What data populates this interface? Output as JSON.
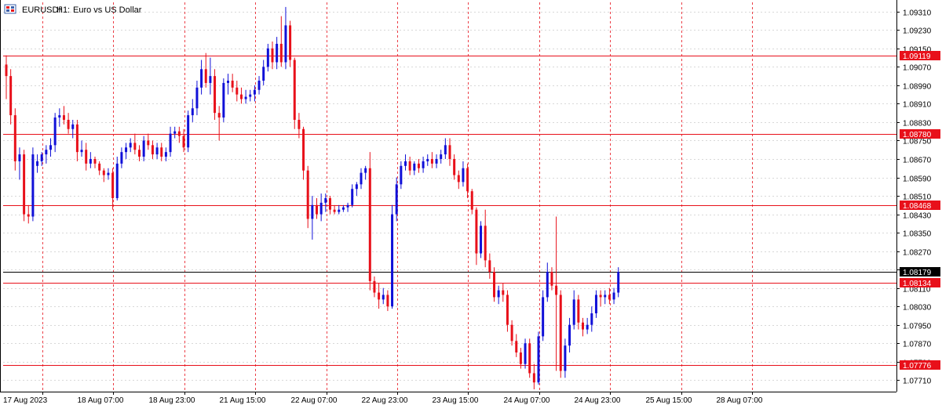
{
  "header": {
    "symbol": "EURUSDf",
    "timeframe": "H1:",
    "description": "Euro vs US Dollar",
    "icon": "chart-window-icon"
  },
  "colors": {
    "bull": "#1010d8",
    "bear": "#e8101a",
    "doji": "#4caf50",
    "hline": "#e8101a",
    "current_line": "#000000",
    "grid": "#d8d8d8",
    "vgrid": "#e8101a",
    "axis": "#000000"
  },
  "price_axis": {
    "min": 1.0766,
    "max": 1.0935,
    "ticks": [
      "1.09310",
      "1.09230",
      "1.09150",
      "1.09070",
      "1.08990",
      "1.08910",
      "1.08830",
      "1.08750",
      "1.08670",
      "1.08590",
      "1.08510",
      "1.08430",
      "1.08350",
      "1.08270",
      "1.08190",
      "1.08110",
      "1.08030",
      "1.07950",
      "1.07870",
      "1.07790",
      "1.07710"
    ]
  },
  "time_axis": {
    "labels": [
      "17 Aug 2023",
      "18 Aug 07:00",
      "18 Aug 23:00",
      "21 Aug 15:00",
      "22 Aug 07:00",
      "22 Aug 23:00",
      "23 Aug 15:00",
      "24 Aug 07:00",
      "24 Aug 23:00",
      "25 Aug 15:00",
      "28 Aug 07:00"
    ],
    "label_bar_index": [
      0,
      16,
      32,
      48,
      64,
      80,
      96,
      112,
      128,
      144,
      160
    ]
  },
  "horizontal_levels": [
    {
      "price": 1.09119,
      "label": "1.09119"
    },
    {
      "price": 1.0878,
      "label": "1.08780"
    },
    {
      "price": 1.08468,
      "label": "1.08468"
    },
    {
      "price": 1.08134,
      "label": "1.08134"
    },
    {
      "price": 1.07776,
      "label": "1.07776"
    }
  ],
  "current_price": {
    "price": 1.08179,
    "label": "1.08179"
  },
  "chart_data": {
    "type": "candlestick",
    "symbol": "EURUSDf",
    "timeframe": "H1",
    "candles": [
      [
        1.0908,
        1.0912,
        1.0893,
        1.0903
      ],
      [
        1.0903,
        1.0906,
        1.0882,
        1.0886
      ],
      [
        1.0886,
        1.0889,
        1.0862,
        1.0866
      ],
      [
        1.0866,
        1.0872,
        1.0858,
        1.0869
      ],
      [
        1.0869,
        1.0871,
        1.084,
        1.0843
      ],
      [
        1.0843,
        1.0847,
        1.0839,
        1.0842
      ],
      [
        1.0842,
        1.0872,
        1.084,
        1.0869
      ],
      [
        1.0864,
        1.0869,
        1.0861,
        1.0866
      ],
      [
        1.0866,
        1.087,
        1.0864,
        1.0869
      ],
      [
        1.0869,
        1.0873,
        1.0865,
        1.0871
      ],
      [
        1.0871,
        1.0876,
        1.0868,
        1.0873
      ],
      [
        1.0873,
        1.0887,
        1.087,
        1.0885
      ],
      [
        1.0885,
        1.0889,
        1.0881,
        1.0886
      ],
      [
        1.0886,
        1.089,
        1.0882,
        1.0884
      ],
      [
        1.0884,
        1.0887,
        1.0878,
        1.088
      ],
      [
        1.088,
        1.0884,
        1.0876,
        1.0882
      ],
      [
        1.0882,
        1.0884,
        1.0866,
        1.087
      ],
      [
        1.087,
        1.0875,
        1.0868,
        1.0871
      ],
      [
        1.0871,
        1.0874,
        1.0862,
        1.0865
      ],
      [
        1.0865,
        1.087,
        1.0863,
        1.0867
      ],
      [
        1.0867,
        1.0868,
        1.0863,
        1.0865
      ],
      [
        1.0865,
        1.0866,
        1.086,
        1.0862
      ],
      [
        1.0862,
        1.0863,
        1.0857,
        1.086
      ],
      [
        1.086,
        1.0863,
        1.0858,
        1.0861
      ],
      [
        1.0861,
        1.0863,
        1.0845,
        1.085
      ],
      [
        1.085,
        1.0868,
        1.0849,
        1.0865
      ],
      [
        1.0865,
        1.0872,
        1.0863,
        1.087
      ],
      [
        1.087,
        1.0874,
        1.0867,
        1.0872
      ],
      [
        1.0872,
        1.0876,
        1.087,
        1.0874
      ],
      [
        1.0874,
        1.0878,
        1.0869,
        1.0871
      ],
      [
        1.0871,
        1.0873,
        1.0866,
        1.0868
      ],
      [
        1.0868,
        1.0877,
        1.0866,
        1.0875
      ],
      [
        1.0875,
        1.0878,
        1.0871,
        1.0873
      ],
      [
        1.0873,
        1.0875,
        1.0867,
        1.0869
      ],
      [
        1.0869,
        1.0874,
        1.0867,
        1.0872
      ],
      [
        1.0872,
        1.0874,
        1.0866,
        1.0868
      ],
      [
        1.0868,
        1.0872,
        1.0866,
        1.087
      ],
      [
        1.087,
        1.0881,
        1.0868,
        1.0878
      ],
      [
        1.0878,
        1.0881,
        1.0876,
        1.0879
      ],
      [
        1.0879,
        1.0881,
        1.0874,
        1.0877
      ],
      [
        1.0877,
        1.088,
        1.087,
        1.0872
      ],
      [
        1.0872,
        1.0888,
        1.087,
        1.0886
      ],
      [
        1.0886,
        1.0893,
        1.0883,
        1.0889
      ],
      [
        1.0889,
        1.0901,
        1.0886,
        1.0898
      ],
      [
        1.0898,
        1.091,
        1.0895,
        1.0906
      ],
      [
        1.0906,
        1.0913,
        1.0898,
        1.09
      ],
      [
        1.09,
        1.0911,
        1.0895,
        1.0903
      ],
      [
        1.0903,
        1.0906,
        1.0884,
        1.0887
      ],
      [
        1.0887,
        1.089,
        1.0875,
        1.0885
      ],
      [
        1.0885,
        1.0902,
        1.0883,
        1.09
      ],
      [
        1.09,
        1.0904,
        1.0895,
        1.0901
      ],
      [
        1.0901,
        1.0904,
        1.0896,
        1.0898
      ],
      [
        1.0898,
        1.0901,
        1.0892,
        1.0895
      ],
      [
        1.0895,
        1.0898,
        1.0891,
        1.0893
      ],
      [
        1.0893,
        1.0897,
        1.0891,
        1.0894
      ],
      [
        1.0894,
        1.0897,
        1.0892,
        1.0895
      ],
      [
        1.0895,
        1.0899,
        1.0892,
        1.0897
      ],
      [
        1.0897,
        1.0903,
        1.0895,
        1.0901
      ],
      [
        1.0901,
        1.091,
        1.0899,
        1.0907
      ],
      [
        1.0907,
        1.0917,
        1.0905,
        1.0915
      ],
      [
        1.0915,
        1.0918,
        1.0906,
        1.0909
      ],
      [
        1.0909,
        1.092,
        1.0906,
        1.0917
      ],
      [
        1.0917,
        1.0929,
        1.0907,
        1.0909
      ],
      [
        1.0909,
        1.0933,
        1.0906,
        1.0925
      ],
      [
        1.0925,
        1.0927,
        1.0907,
        1.091
      ],
      [
        1.091,
        1.0911,
        1.088,
        1.0884
      ],
      [
        1.0884,
        1.0887,
        1.0876,
        1.088
      ],
      [
        1.088,
        1.0881,
        1.0858,
        1.0862
      ],
      [
        1.0862,
        1.0864,
        1.0837,
        1.0841
      ],
      [
        1.0841,
        1.0851,
        1.0832,
        1.0847
      ],
      [
        1.0847,
        1.085,
        1.0841,
        1.0843
      ],
      [
        1.0843,
        1.0852,
        1.084,
        1.0848
      ],
      [
        1.0848,
        1.0852,
        1.0844,
        1.085
      ],
      [
        1.085,
        1.0851,
        1.0843,
        1.0845
      ],
      [
        1.0845,
        1.0847,
        1.0843,
        1.0844
      ],
      [
        1.0844,
        1.0847,
        1.0843,
        1.0845
      ],
      [
        1.0845,
        1.0847,
        1.0844,
        1.0846
      ],
      [
        1.0846,
        1.0848,
        1.0844,
        1.0847
      ],
      [
        1.0847,
        1.0856,
        1.0846,
        1.0854
      ],
      [
        1.0854,
        1.0857,
        1.0851,
        1.0856
      ],
      [
        1.0856,
        1.0863,
        1.0854,
        1.0861
      ],
      [
        1.0861,
        1.0864,
        1.0858,
        1.0863
      ],
      [
        1.0863,
        1.087,
        1.081,
        1.0814
      ],
      [
        1.0814,
        1.0816,
        1.0807,
        1.0809
      ],
      [
        1.0809,
        1.0813,
        1.0802,
        1.0806
      ],
      [
        1.0806,
        1.0811,
        1.0804,
        1.0808
      ],
      [
        1.0808,
        1.081,
        1.0801,
        1.0803
      ],
      [
        1.0803,
        1.0847,
        1.0802,
        1.0843
      ],
      [
        1.0843,
        1.0859,
        1.084,
        1.0856
      ],
      [
        1.0856,
        1.0866,
        1.0854,
        1.0864
      ],
      [
        1.0864,
        1.0869,
        1.0862,
        1.0866
      ],
      [
        1.0866,
        1.0868,
        1.086,
        1.0862
      ],
      [
        1.0862,
        1.0866,
        1.086,
        1.0865
      ],
      [
        1.0865,
        1.0867,
        1.0861,
        1.0863
      ],
      [
        1.0863,
        1.0868,
        1.0861,
        1.0866
      ],
      [
        1.0866,
        1.0869,
        1.0864,
        1.0867
      ],
      [
        1.0867,
        1.087,
        1.0863,
        1.0865
      ],
      [
        1.0865,
        1.0869,
        1.0863,
        1.0867
      ],
      [
        1.0867,
        1.0871,
        1.0865,
        1.0869
      ],
      [
        1.0869,
        1.0876,
        1.0867,
        1.0873
      ],
      [
        1.0873,
        1.0876,
        1.0864,
        1.0867
      ],
      [
        1.0867,
        1.0869,
        1.0858,
        1.086
      ],
      [
        1.086,
        1.0862,
        1.0854,
        1.0857
      ],
      [
        1.0857,
        1.0866,
        1.0855,
        1.0863
      ],
      [
        1.0863,
        1.0865,
        1.085,
        1.0853
      ],
      [
        1.0853,
        1.0854,
        1.0843,
        1.0845
      ],
      [
        1.0845,
        1.0846,
        1.0821,
        1.0826
      ],
      [
        1.0826,
        1.084,
        1.0824,
        1.0838
      ],
      [
        1.0838,
        1.0845,
        1.082,
        1.0823
      ],
      [
        1.0823,
        1.0826,
        1.0815,
        1.0818
      ],
      [
        1.0818,
        1.082,
        1.0805,
        1.0807
      ],
      [
        1.0807,
        1.0812,
        1.0804,
        1.081
      ],
      [
        1.081,
        1.0813,
        1.0805,
        1.0808
      ],
      [
        1.0808,
        1.081,
        1.0792,
        1.0795
      ],
      [
        1.0795,
        1.0797,
        1.0786,
        1.0788
      ],
      [
        1.0788,
        1.0791,
        1.0781,
        1.0783
      ],
      [
        1.0783,
        1.0785,
        1.0776,
        1.0778
      ],
      [
        1.0778,
        1.0789,
        1.0776,
        1.0787
      ],
      [
        1.0787,
        1.0789,
        1.0772,
        1.0774
      ],
      [
        1.0774,
        1.0778,
        1.0767,
        1.077
      ],
      [
        1.077,
        1.0792,
        1.0769,
        1.079
      ],
      [
        1.079,
        1.081,
        1.0788,
        1.0807
      ],
      [
        1.0807,
        1.0822,
        1.0805,
        1.0818
      ],
      [
        1.0818,
        1.082,
        1.081,
        1.0812
      ],
      [
        1.0812,
        1.0842,
        1.0775,
        1.0808
      ],
      [
        1.0808,
        1.081,
        1.0772,
        1.0775
      ],
      [
        1.0775,
        1.0789,
        1.0772,
        1.0786
      ],
      [
        1.0786,
        1.0798,
        1.0783,
        1.0795
      ],
      [
        1.0795,
        1.081,
        1.0793,
        1.0806
      ],
      [
        1.0806,
        1.0808,
        1.0793,
        1.0796
      ],
      [
        1.0796,
        1.0798,
        1.079,
        1.0793
      ],
      [
        1.0793,
        1.0798,
        1.0791,
        1.0795
      ],
      [
        1.0795,
        1.0803,
        1.0792,
        1.08
      ],
      [
        1.08,
        1.081,
        1.0798,
        1.0808
      ],
      [
        1.0808,
        1.081,
        1.0803,
        1.0807
      ],
      [
        1.0807,
        1.081,
        1.0804,
        1.0808
      ],
      [
        1.0808,
        1.0811,
        1.0804,
        1.0806
      ],
      [
        1.0806,
        1.0811,
        1.0804,
        1.0809
      ],
      [
        1.0809,
        1.082,
        1.0807,
        1.0818
      ]
    ]
  }
}
